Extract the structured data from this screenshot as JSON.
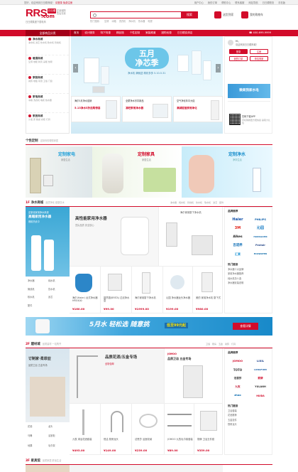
{
  "topbar": {
    "welcome": "您好，欢迎来到日日顺商城！",
    "login": "请登录",
    "register": "免费注册",
    "links": [
      "用户中心",
      "我的订单",
      "帮助中心",
      "联系客服",
      "网站导航",
      "日日顺物流",
      "手机版"
    ]
  },
  "logo": {
    "main": "RRS",
    "dot": ".com",
    "badge": "日日顺",
    "sub": "日日顺集团下属电商",
    "tag1": "正品保障",
    "tag2": "售后无忧"
  },
  "search": {
    "placeholder": "",
    "button": "搜索",
    "hot": [
      "热门搜索：",
      "空调",
      "冰箱",
      "洗衣机",
      "净水机",
      "热水器",
      "电视"
    ]
  },
  "header_buttons": {
    "cart": "我的购物车",
    "service": "送货到家"
  },
  "nav": {
    "category": "全部商品分类",
    "items": [
      "首页",
      "设计服务",
      "特下特惠",
      "精品馆",
      "个性定制",
      "家装频道",
      "团购优惠",
      "日日顺实体店"
    ],
    "phone": "400-699-9999"
  },
  "sidebar": [
    {
      "title": "净水商城",
      "sub": "净水机 滤芯 饮水机 软水机 管线机"
    },
    {
      "title": "暖通商城",
      "sub": "空调 地暖 新风 采暖 热泵"
    },
    {
      "title": "家装商城",
      "sub": "瓷砖 地板 吊顶 卫浴 门窗"
    },
    {
      "title": "家电商城",
      "sub": "冰箱 洗衣机 电视 热水器"
    },
    {
      "title": "家居商城",
      "sub": "沙发 床 餐桌 衣柜 灯具"
    }
  ],
  "banner": {
    "title_line1": "五月",
    "title_line2": "净芯季",
    "sub": "净水机 满就送 精彩多多 5.10-5.31"
  },
  "thumbs": [
    {
      "t1": "海尔5月净水促销",
      "t2": "5.13净水5折选购惊喜"
    },
    {
      "t1": "全屋净水尽享新品",
      "t2": "凑旺家用净水器"
    },
    {
      "t1": "空气净化年中大促",
      "t2": "满减超值家用净化"
    }
  ],
  "right": {
    "greeting": "Hi，",
    "welcome": "欢迎来到日日顺商城！",
    "login": "登录",
    "register": "注册",
    "shop": "我的订单",
    "join": "申请商家",
    "promo": "微商我家水电",
    "app_text": "扫码下载APP",
    "app_sub": "手机购物更方便快捷 赢取大礼包"
  },
  "custom": {
    "title": "个性定制",
    "desc": "定制你的理想家居",
    "cards": [
      {
        "t": "定制家电",
        "s": "家居生活"
      },
      {
        "t": "定制家具",
        "s": "家居生活"
      },
      {
        "t": "定制净水",
        "s": "净享生活"
      }
    ]
  },
  "floor1": {
    "num": "1F",
    "title": "净水商城",
    "desc": "品质净化 健康饮水",
    "tabs": [
      "净水器",
      "纯水机",
      "管线机",
      "饮水机",
      "软水机",
      "滤芯",
      "配件"
    ],
    "promo_text": "定制化家用净水系统",
    "promo_sub": "高端家用净水器",
    "promo_sub2": "爆款热卖中",
    "feature": {
      "t1": "高性能家用净水器",
      "s": "顶尖品质 安全放心"
    },
    "tiles": [
      {
        "name": "海尔(Haier) 台式净水器 HRO400",
        "price": "¥160.00"
      },
      {
        "name": "碧然德(BRITA) 过滤净水壶",
        "price": "¥99.00"
      },
      {
        "name": "海尔家用厨下净水机",
        "price": "¥1999.00"
      },
      {
        "name": "沁园 净水器龙头净水器",
        "price": "¥199.00"
      },
      {
        "name": "美的 家用净水机 厨下式",
        "price": "¥980.00"
      }
    ],
    "brands_title": "品牌推荐",
    "brands": [
      "Haier",
      "PHILIPS",
      "3M",
      "沁园",
      "Alkes",
      "HANSGOHR",
      "百诺养",
      "Pentair",
      "汇莱",
      "ECOWATER"
    ],
    "links_title": "热门链接",
    "links": [
      "净水器十大品牌",
      "家用净水器推荐",
      "纯水机怎么选",
      "净水器安装说明"
    ]
  },
  "bar_ad": {
    "big": "5月水 轻松选 随意挑",
    "price": "低至99元起",
    "btn": "查看详情"
  },
  "floor2": {
    "num": "2F",
    "title": "建材城",
    "desc": "品质建材 一站购齐",
    "tabs": [
      "卫浴",
      "厨房",
      "五金",
      "瓷砖",
      "灯具"
    ],
    "promo_title": "订制家·柔菲亚",
    "promo_sub": "品质卫浴 五金专场",
    "feature_t": "品质花洒/五金专场",
    "feature_s": "全场包邮",
    "tiles": [
      {
        "name": "九牧 淋浴花洒套装",
        "price": "¥493.00"
      },
      {
        "name": "恒洁 厨房龙头",
        "price": "¥149.00"
      },
      {
        "name": "法恩莎 浴室收纳",
        "price": "¥239.00"
      },
      {
        "name": "JOMOO 九牧毛巾架套装",
        "price": "¥89.00"
      },
      {
        "name": "箭牌 卫浴五件套",
        "price": "¥359.00"
      }
    ],
    "brands": [
      "JOMOO",
      "LIXIL",
      "TOTO",
      "LONGFIRM",
      "法恩莎",
      "箭牌",
      "九牧",
      "YULANH",
      "zhao",
      "HUIDA"
    ],
    "side_links": [
      "花洒",
      "龙头",
      "马桶",
      "浴室柜",
      "地漏",
      "毛巾架"
    ],
    "hot_title": "热门链接",
    "hot": [
      "卫浴套装",
      "花洒推荐",
      "五金挂件",
      "厨房龙头"
    ]
  },
  "floor3": {
    "num": "3F",
    "title": "家具馆",
    "desc": "品质家居 舒适生活"
  },
  "colors": {
    "brand": "#d20b2a",
    "dark": "#a30018"
  }
}
